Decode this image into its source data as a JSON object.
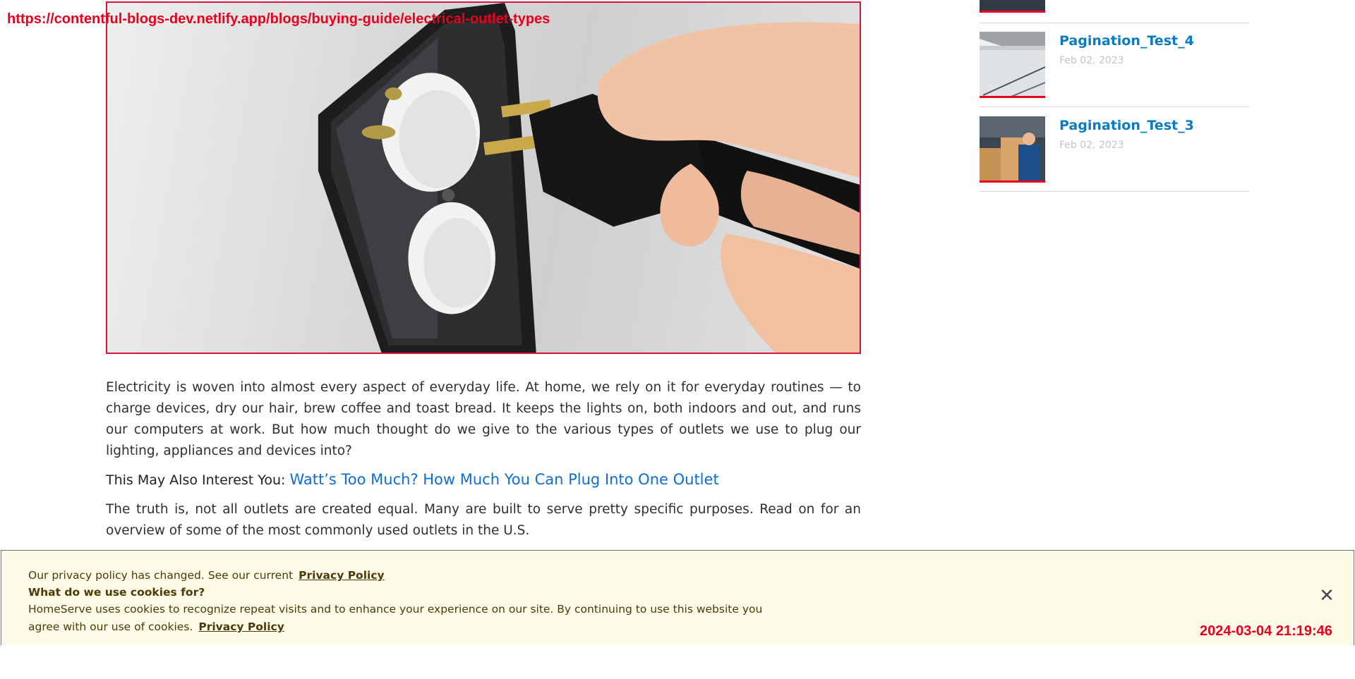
{
  "overlay": {
    "url": "https://contentful-blogs-dev.netlify.app/blogs/buying-guide/electrical-outlet-types",
    "timestamp": "2024-03-04 21:19:46"
  },
  "hero": {
    "alt_subject": "hand-plugging-into-outlet-image"
  },
  "article": {
    "paragraph_1": "Electricity is woven into almost every aspect of everyday life. At home, we rely on it for everyday routines — to charge devices, dry our hair, brew coffee and toast bread. It keeps the lights on, both indoors and out, and runs our computers at work. But how much thought do we give to the various types of outlets we use to plug our lighting, appliances and devices into?",
    "interest_label": "This May Also Interest You:",
    "interest_link": "Watt’s Too Much? How Much You Can Plug Into One Outlet",
    "paragraph_2": "The truth is, not all outlets are created equal. Many are built to serve pretty specific purposes. Read on for an overview of some of the most commonly used outlets in the U.S."
  },
  "sidebar": {
    "items": [
      {
        "title": "Pagination_Test_4",
        "date": "Feb 02, 2023",
        "thumb_icon": "house-gutter-icon"
      },
      {
        "title": "Pagination_Test_3",
        "date": "Feb 02, 2023",
        "thumb_icon": "technician-icon"
      }
    ]
  },
  "cookie_banner": {
    "line1": "Our privacy policy has changed. See our current",
    "line1_link": "Privacy Policy",
    "line2": "What do we use cookies for?",
    "line3": "HomeServe uses cookies to recognize repeat visits and to enhance your experience on our site. By continuing to use this website you",
    "line4": "agree with our use of cookies.",
    "line4_link": "Privacy Policy",
    "close_symbol": "✕"
  },
  "colors": {
    "accent_red": "#e8001c",
    "link_blue": "#0d6fd6",
    "sidebar_title_blue": "#0a7cc1",
    "cookie_bg": "#fffbe9"
  }
}
